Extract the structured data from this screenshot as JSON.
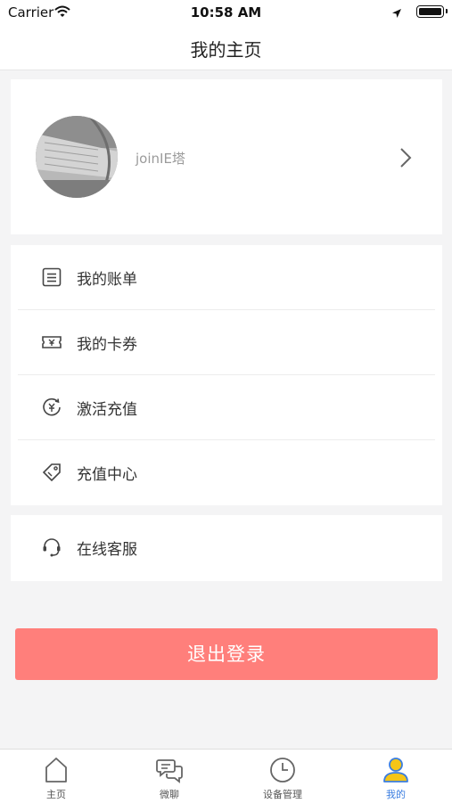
{
  "status_bar": {
    "carrier": "Carrier",
    "time": "10:58 AM"
  },
  "nav": {
    "title": "我的主页"
  },
  "profile": {
    "username": "joinIE塔"
  },
  "menu": {
    "items": [
      {
        "label": "我的账单",
        "icon": "bill-list-icon"
      },
      {
        "label": "我的卡券",
        "icon": "ticket-icon"
      },
      {
        "label": "激活充值",
        "icon": "activate-recharge-icon"
      },
      {
        "label": "充值中心",
        "icon": "tag-icon"
      }
    ],
    "service": {
      "label": "在线客服",
      "icon": "headset-icon"
    }
  },
  "logout": {
    "label": "退出登录"
  },
  "tabs": [
    {
      "label": "主页",
      "icon": "home-icon",
      "active": false
    },
    {
      "label": "微聊",
      "icon": "chat-icon",
      "active": false
    },
    {
      "label": "设备管理",
      "icon": "clock-icon",
      "active": false
    },
    {
      "label": "我的",
      "icon": "user-icon",
      "active": true
    }
  ],
  "colors": {
    "logout_button": "#ff7f7b",
    "tab_active": "#3a7de0",
    "tab_active_icon": "#f5c518"
  }
}
